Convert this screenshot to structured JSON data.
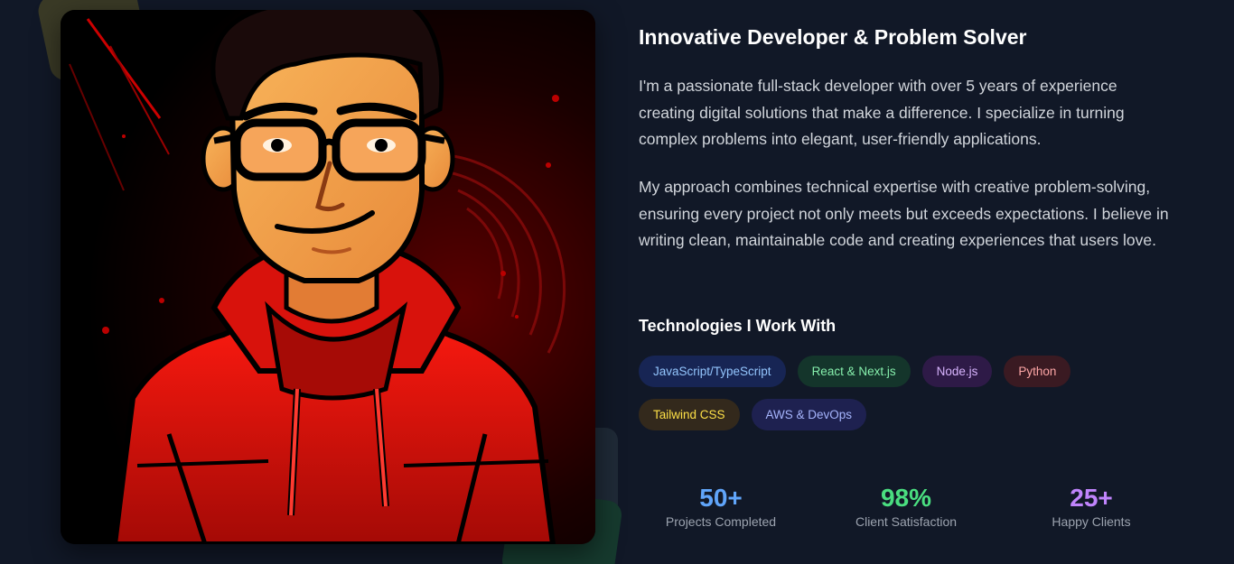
{
  "about": {
    "heading": "Innovative Developer & Problem Solver",
    "paragraphs": [
      "I'm a passionate full-stack developer with over 5 years of experience creating digital solutions that make a difference. I specialize in turning complex problems into elegant, user-friendly applications.",
      "My approach combines technical expertise with creative problem-solving, ensuring every project not only meets but exceeds expectations. I believe in writing clean, maintainable code and creating experiences that users love."
    ],
    "technologies_heading": "Technologies I Work With",
    "technologies": [
      {
        "label": "JavaScript/TypeScript",
        "bg": "#172554",
        "color": "#93c5fd"
      },
      {
        "label": "React & Next.js",
        "bg": "#14352b",
        "color": "#86efac"
      },
      {
        "label": "Node.js",
        "bg": "#2e1a47",
        "color": "#d8b4fe"
      },
      {
        "label": "Python",
        "bg": "#3a1a22",
        "color": "#fca5a5"
      },
      {
        "label": "Tailwind CSS",
        "bg": "#33291c",
        "color": "#fde047"
      },
      {
        "label": "AWS & DevOps",
        "bg": "#1e2150",
        "color": "#a5b4fc"
      }
    ],
    "stats": [
      {
        "value": "50+",
        "label": "Projects Completed",
        "color": "#60a5fa"
      },
      {
        "value": "98%",
        "label": "Client Satisfaction",
        "color": "#4ade80"
      },
      {
        "value": "25+",
        "label": "Happy Clients",
        "color": "#c084fc"
      }
    ]
  },
  "portrait": {
    "icon": "developer-avatar-illustration",
    "accent": "#e3150f"
  }
}
